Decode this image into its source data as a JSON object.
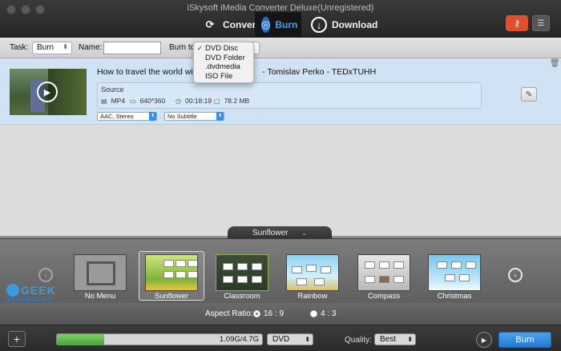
{
  "window": {
    "title": "iSkysoft iMedia Converter Deluxe(Unregistered)"
  },
  "modes": [
    {
      "label": "Convert",
      "icon": "convert-icon"
    },
    {
      "label": "Burn",
      "icon": "disc-icon"
    },
    {
      "label": "Download",
      "icon": "download-icon"
    }
  ],
  "toolbar": {
    "task_label": "Task:",
    "task_value": "Burn",
    "name_label": "Name:",
    "name_value": "",
    "burn_to_label": "Burn to"
  },
  "burn_menu": {
    "items": [
      "DVD Disc",
      "DVD Folder",
      ".dvdmedia",
      "ISO File"
    ],
    "checked": "DVD Disc"
  },
  "file": {
    "title_before": "How to travel the world with",
    "title_after": "- Tomislav Perko - TEDxTUHH",
    "source_label": "Source",
    "format": "MP4",
    "resolution": "640*360",
    "duration": "00:18:19",
    "size": "78.2 MB",
    "audio": "AAC, Stereo",
    "subtitle": "No Subtitle"
  },
  "template_panel": {
    "current": "Sunflower",
    "items": [
      "No Menu",
      "Sunflower",
      "Classroom",
      "Rainbow",
      "Compass",
      "Christmas"
    ],
    "selected": "Sunflower"
  },
  "watermark": {
    "line1": "GEEK",
    "line2": "DASHBOARD"
  },
  "aspect": {
    "label": "Aspect Ratio:",
    "options": [
      "16 : 9",
      "4 : 3"
    ],
    "selected": "16 : 9"
  },
  "bottom": {
    "capacity_text": "1.09G/4.7G",
    "capacity_fraction": 0.23,
    "disc_type": "DVD",
    "quality_label": "Quality:",
    "quality_value": "Best",
    "burn_label": "Burn"
  },
  "colors": {
    "accent": "#3d8de0",
    "selected_row": "#cfe3f5",
    "progress": "#47a63a",
    "alert": "#e0502c"
  }
}
